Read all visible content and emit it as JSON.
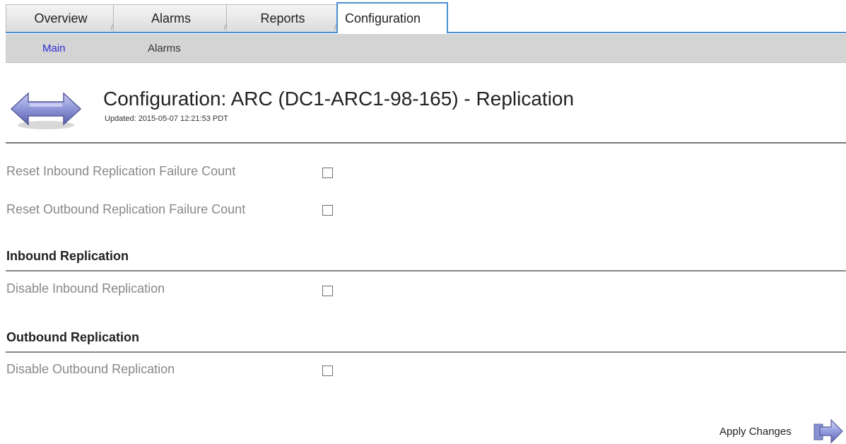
{
  "tabs": [
    {
      "label": "Overview"
    },
    {
      "label": "Alarms"
    },
    {
      "label": "Reports"
    },
    {
      "label": "Configuration",
      "active": true
    }
  ],
  "subnav": [
    {
      "label": "Main",
      "active": true
    },
    {
      "label": "Alarms"
    }
  ],
  "header": {
    "title": "Configuration: ARC (DC1-ARC1-98-165) - Replication",
    "updated": "Updated: 2015-05-07 12:21:53 PDT",
    "icon": "replication-arrows-icon"
  },
  "rows": [
    {
      "label": "Reset Inbound Replication Failure Count",
      "checked": false
    },
    {
      "label": "Reset Outbound Replication Failure Count",
      "checked": false
    }
  ],
  "sections": [
    {
      "heading": "Inbound Replication",
      "rows": [
        {
          "label": "Disable Inbound Replication",
          "checked": false
        }
      ]
    },
    {
      "heading": "Outbound Replication",
      "rows": [
        {
          "label": "Disable Outbound Replication",
          "checked": false
        }
      ]
    }
  ],
  "apply": {
    "label": "Apply Changes",
    "icon": "arrow-right-icon"
  },
  "colors": {
    "tab_accent": "#4a8fd0",
    "subnav_bg": "#d4d4d4",
    "active_link": "#2a2ad4",
    "label_gray": "#888888"
  }
}
